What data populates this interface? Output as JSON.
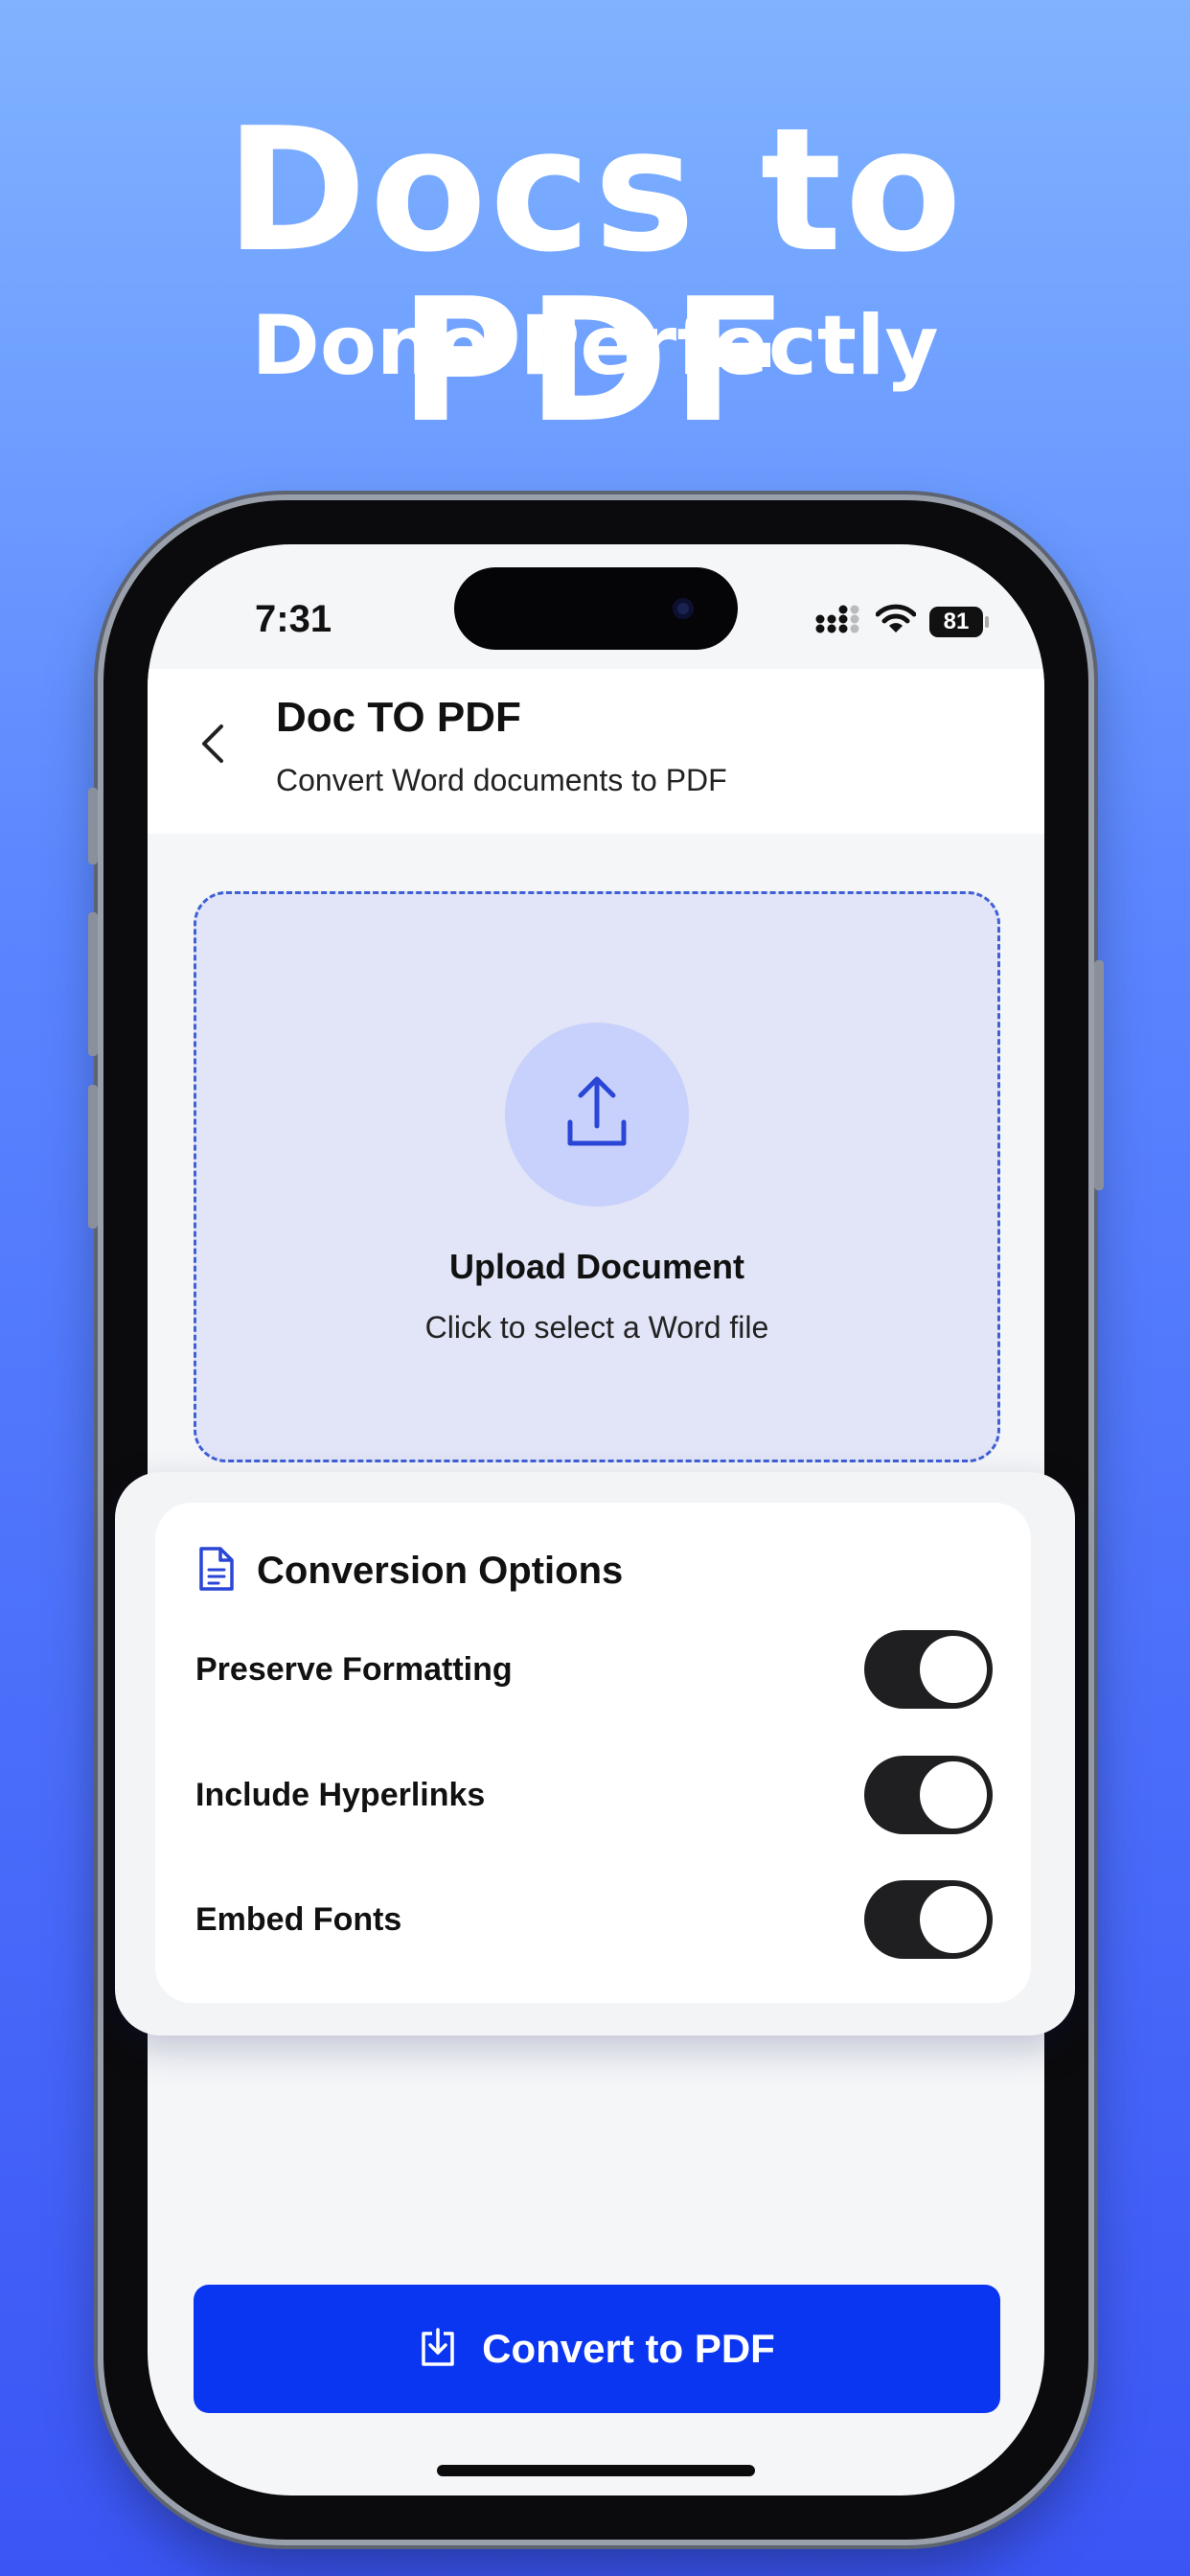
{
  "promo": {
    "title": "Docs to PDF",
    "subtitle": "Done Perfectly"
  },
  "status_bar": {
    "time": "7:31",
    "battery": "81",
    "icons": [
      "signal-icon",
      "wifi-icon",
      "battery-icon"
    ]
  },
  "header": {
    "back_icon": "chevron-left-icon",
    "title": "Doc TO PDF",
    "subtitle": "Convert Word documents to PDF"
  },
  "upload": {
    "icon": "upload-icon",
    "title": "Upload Document",
    "hint": "Click to select a Word file"
  },
  "options": {
    "icon": "document-icon",
    "title": "Conversion Options",
    "items": [
      {
        "label": "Preserve Formatting",
        "enabled": true
      },
      {
        "label": "Include Hyperlinks",
        "enabled": true
      },
      {
        "label": "Embed Fonts",
        "enabled": true
      }
    ]
  },
  "convert_button": {
    "icon": "download-icon",
    "label": "Convert to PDF"
  },
  "colors": {
    "primary": "#0a36f2",
    "accent_border": "#3f5fd6",
    "upload_bg": "#e1e5f7",
    "toggle_on": "#1f1f21",
    "background_top": "#7fb3ff",
    "background_bottom": "#3b55f5"
  }
}
